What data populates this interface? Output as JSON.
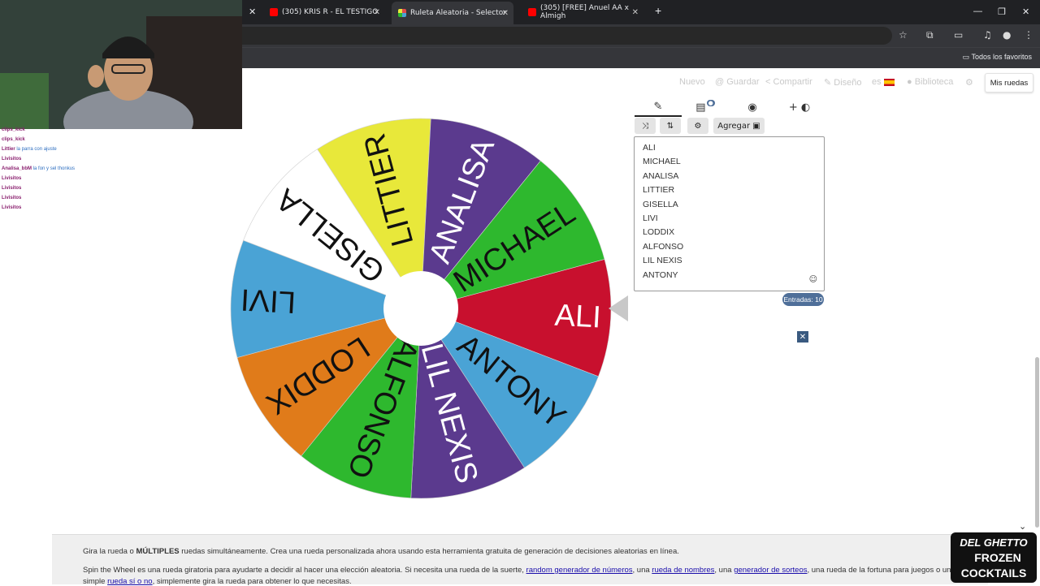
{
  "browser": {
    "tabs": [
      {
        "label": "(305) KRIS R - EL TESTIGO",
        "favicon_color": "#ff0000",
        "active": false
      },
      {
        "label": "Ruleta Aleatoria - Selector",
        "favicon_color": "#e14b4b",
        "active": true
      },
      {
        "label": "(305) [FREE] Anuel AA x Almigh",
        "favicon_color": "#ff0000",
        "active": false
      }
    ],
    "new_tab_icon": "plus-icon",
    "bookmarks_all": "Todos los favoritos"
  },
  "chat": [
    {
      "user": "clips_kick",
      "msg": ""
    },
    {
      "user": "clips_kick",
      "msg": ""
    },
    {
      "user": "Littier",
      "msg": "la parra con ajuste"
    },
    {
      "user": "Livisitos",
      "msg": ""
    },
    {
      "user": "Analisa_bbM",
      "msg": "la fon y sel thonkus"
    },
    {
      "user": "Livisitos",
      "msg": ""
    },
    {
      "user": "Livisitos",
      "msg": ""
    },
    {
      "user": "Livisitos",
      "msg": ""
    },
    {
      "user": "Livisitos",
      "msg": ""
    }
  ],
  "header": {
    "nav": [
      {
        "icon": "",
        "label": "Nuevo"
      },
      {
        "icon": "@",
        "label": "Guardar"
      },
      {
        "icon": "<",
        "label": "Compartir"
      },
      {
        "icon": "✎",
        "label": "Diseño"
      }
    ],
    "language": "es",
    "library": "Biblioteca",
    "my_wheels": "Mis ruedas"
  },
  "wheel": {
    "segments": [
      {
        "label": "ALI",
        "color": "#c8102e",
        "text_color": "#ffffff"
      },
      {
        "label": "ANTONY",
        "color": "#4aa3d5",
        "text_color": "#111111"
      },
      {
        "label": "LIL NEXIS",
        "color": "#5b3a8e",
        "text_color": "#ffffff"
      },
      {
        "label": "ALFONSO",
        "color": "#2eb82e",
        "text_color": "#111111"
      },
      {
        "label": "LODDIX",
        "color": "#e07b1a",
        "text_color": "#111111"
      },
      {
        "label": "LIVI",
        "color": "#4aa3d5",
        "text_color": "#111111"
      },
      {
        "label": "GISELLA",
        "color": "#ffffff",
        "text_color": "#111111"
      },
      {
        "label": "LITTIER",
        "color": "#e8e83a",
        "text_color": "#111111"
      },
      {
        "label": "ANALISA",
        "color": "#5b3a8e",
        "text_color": "#ffffff"
      },
      {
        "label": "MICHAEL",
        "color": "#2eb82e",
        "text_color": "#111111"
      }
    ]
  },
  "panel": {
    "tabs": [
      "pencil-icon",
      "clipboard-icon",
      "eye-off-icon",
      "add-wheel-icon"
    ],
    "tools": {
      "shuffle": "⤨",
      "sort": "⇅",
      "settings": "⚙",
      "add_label": "Agregar"
    },
    "entries": [
      "ALI",
      "MICHAEL",
      "ANALISA",
      "LITTIER",
      "GISELLA",
      "LIVI",
      "LODDIX",
      "ALFONSO",
      "LIL NEXIS",
      "ANTONY"
    ],
    "count_label": "Entradas: 10"
  },
  "description": {
    "line1_pre": "Gira la rueda o ",
    "line1_bold": "MÚLTIPLES",
    "line1_post": " ruedas simultáneamente. Crea una rueda personalizada ahora usando esta herramienta gratuita de generación de decisiones aleatorias en línea.",
    "line2_pre": "Spin the Wheel es una rueda giratoria para ayudarte a decidir al hacer una elección aleatoria. Si necesita una rueda de la suerte, ",
    "link1": "random generador de números",
    "line2_mid1": ", una ",
    "link2": "rueda de nombres",
    "line2_mid2": ", una ",
    "link3": "generador de sorteos",
    "line2_post": ", una rueda de la fortuna para juegos o una",
    "line3_pre": "simple ",
    "link4": "rueda sí o no",
    "line3_post": ", simplemente gira la rueda para obtener lo que necesitas."
  },
  "overlay_logo": {
    "line1": "DEL GHETTO",
    "line2": "FROZEN",
    "line3": "COCKTAILS"
  }
}
